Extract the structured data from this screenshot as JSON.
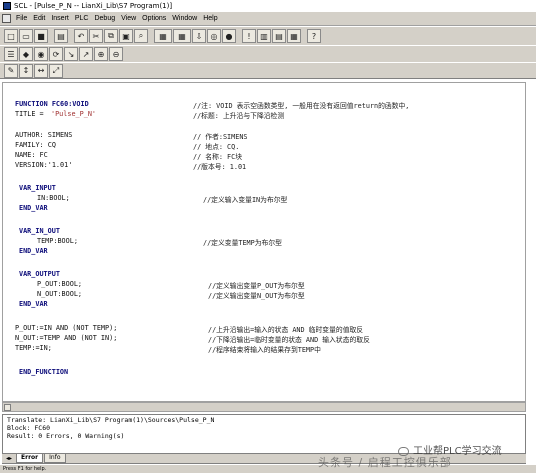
{
  "window": {
    "title": "SCL - [Pulse_P_N -- LianXi_Lib\\S7 Program(1)]"
  },
  "menu": [
    "File",
    "Edit",
    "Insert",
    "PLC",
    "Debug",
    "View",
    "Options",
    "Window",
    "Help"
  ],
  "toolbar1": [
    "new",
    "open",
    "save",
    "print",
    "undo",
    "cut",
    "copy",
    "paste",
    "find",
    "compile",
    "compile-all",
    "download",
    "monitor",
    "breakpoint",
    "help-mark",
    "grid1",
    "grid2",
    "grid3",
    "help"
  ],
  "toolbar2": [
    "list",
    "step",
    "watch",
    "step-over",
    "step-in",
    "step-out",
    "bp1",
    "bp2"
  ],
  "toolbar3": [
    "tool1",
    "tool2",
    "tool3",
    "tool4"
  ],
  "code": {
    "l1a": "FUNCTION FC60:VOID",
    "l1b": "//注: VOID 表示空函数类型, 一般用在没有返回值return的函数中,",
    "l2a": "TITLE = ",
    "l2b": "'Pulse_P_N'",
    "l2c": "//标题: 上升沿与下降沿检测",
    "l3a": "AUTHOR: SIMENS",
    "l3b": "// 作者:SIMENS",
    "l4a": "FAMILY: CQ",
    "l4b": "// 地点: CQ.",
    "l5a": "NAME: FC",
    "l5b": "// 名称: FC块",
    "l6a": "VERSION:'1.01'",
    "l6b": "//版本号: 1.01",
    "l7": "VAR_INPUT",
    "l8a": "IN:BOOL;",
    "l8b": "//定义输入变量IN为布尔型",
    "l9": "END_VAR",
    "l10": "VAR_IN_OUT",
    "l11a": "TEMP:BOOL;",
    "l11b": "//定义变量TEMP为布尔型",
    "l12": "END_VAR",
    "l13": "VAR_OUTPUT",
    "l14a": "P_OUT:BOOL;",
    "l14b": "//定义输出变量P_OUT为布尔型",
    "l15a": "N_OUT:BOOL;",
    "l15b": "//定义输出变量N_OUT为布尔型",
    "l16": "END_VAR",
    "l17a": "P_OUT:=IN AND (NOT TEMP);",
    "l17b": "//上升沿输出=输入的状态 AND 临时变量的值取反",
    "l18a": "N_OUT:=TEMP AND (NOT IN);",
    "l18b": "//下降沿输出=临时变量的状态 AND 输入状态的取反",
    "l19a": "TEMP:=IN;",
    "l19b": "//程序结束将输入的结果存到TEMP中",
    "l20": "END_FUNCTION"
  },
  "output": {
    "line1": "Translate: LianXi_Lib\\S7 Program(1)\\Sources\\Pulse_P_N",
    "line2": "Block: FC60",
    "line3": "Result: 0 Errors, 0 Warning(s)"
  },
  "tabs": [
    "Error",
    "Info"
  ],
  "status": "Press F1 for help.",
  "watermark": {
    "line1": "工业帮PLC学习交流",
    "line2": "头条号 / 启程工控俱乐部"
  }
}
